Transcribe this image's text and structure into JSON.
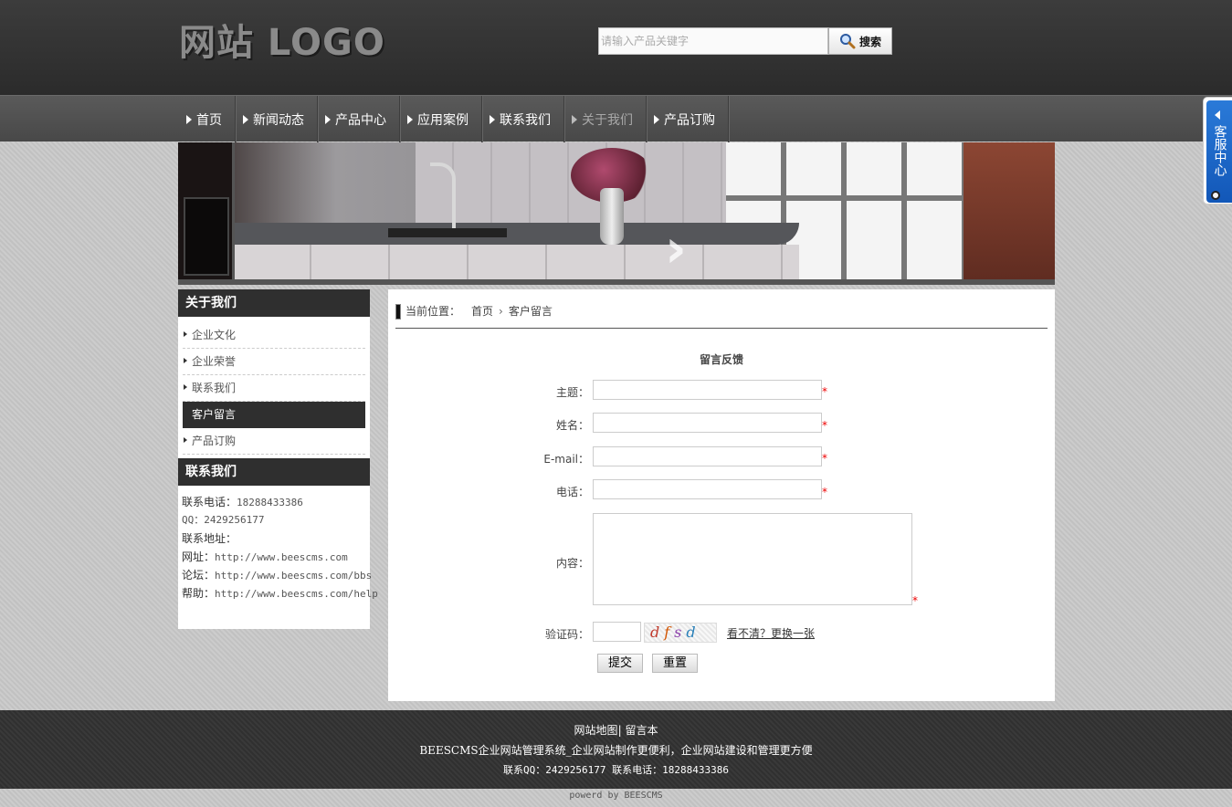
{
  "header": {
    "logo": "网站 LOGO",
    "search_placeholder": "请输入产品关键字",
    "search_button": "搜索"
  },
  "nav": {
    "items": [
      {
        "label": "首页",
        "active": false
      },
      {
        "label": "新闻动态",
        "active": false
      },
      {
        "label": "产品中心",
        "active": false
      },
      {
        "label": "应用案例",
        "active": false
      },
      {
        "label": "联系我们",
        "active": false
      },
      {
        "label": "关于我们",
        "active": true
      },
      {
        "label": "产品订购",
        "active": false
      }
    ]
  },
  "kefu": {
    "label": "客服中心"
  },
  "sidebar": {
    "about_title": "关于我们",
    "about_items": [
      {
        "label": "企业文化",
        "active": false
      },
      {
        "label": "企业荣誉",
        "active": false
      },
      {
        "label": "联系我们",
        "active": false
      },
      {
        "label": "客户留言",
        "active": true
      },
      {
        "label": "产品订购",
        "active": false
      }
    ],
    "contact_title": "联系我们",
    "contact": {
      "phone_label": "联系电话：",
      "phone": "18288433386",
      "qq_label": "QQ：",
      "qq": "2429256177",
      "address_label": "联系地址：",
      "address": "",
      "site_label": "网址：",
      "site": "http://www.beescms.com",
      "forum_label": "论坛：",
      "forum": "http://www.beescms.com/bbs",
      "help_label": "帮助：",
      "help": "http://www.beescms.com/help"
    }
  },
  "breadcrumb": {
    "prefix": "当前位置：",
    "home": "首页",
    "separator": "›",
    "current": "客户留言"
  },
  "form": {
    "title": "留言反馈",
    "subject_label": "主题：",
    "name_label": "姓名：",
    "email_label": "E-mail：",
    "phone_label": "电话：",
    "content_label": "内容：",
    "captcha_label": "验证码：",
    "required_mark": "*",
    "captcha_text": "dfsd",
    "refresh_text": "看不清？更换一张",
    "submit": "提交",
    "reset": "重置"
  },
  "footer": {
    "sitemap": "网站地图",
    "divider": "|",
    "guestbook": "留言本",
    "tagline": "BEESCMS企业网站管理系统_企业网站制作更便利，企业网站建设和管理更方便",
    "contact_line": "联系QQ：2429256177 联系电话：18288433386",
    "powered": "powerd by BEESCMS"
  },
  "colors": {
    "header_bg": "#333333",
    "nav_bg": "#505050",
    "accent_dark": "#2f2f2f",
    "required": "#ee0000",
    "kefu_blue": "#1a66c8"
  }
}
